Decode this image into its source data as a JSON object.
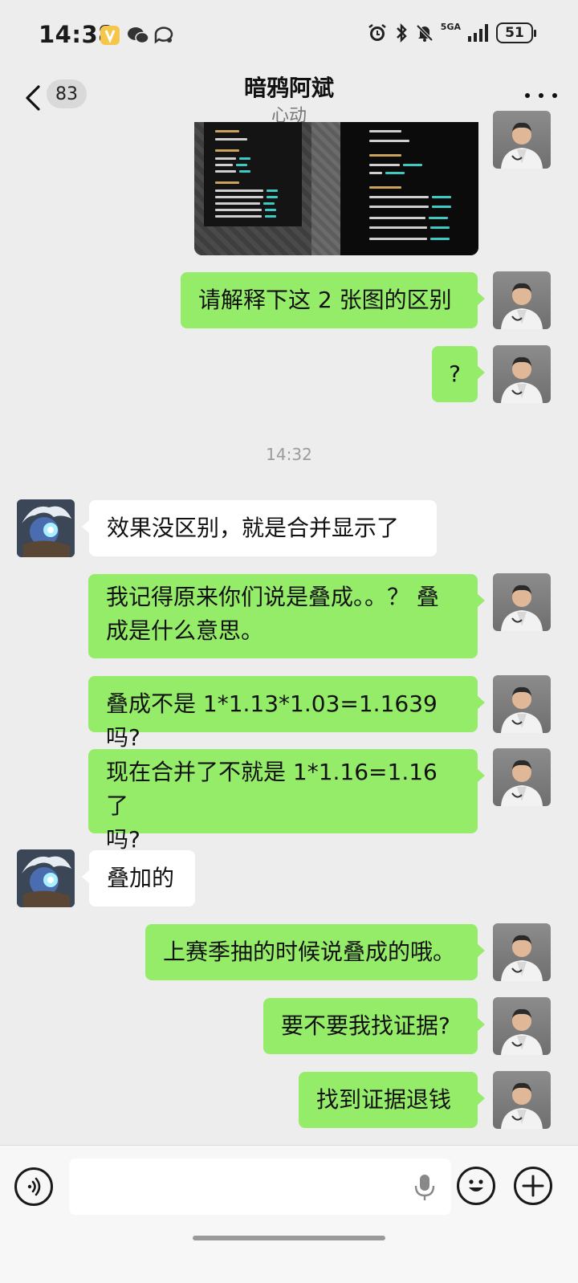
{
  "status_bar": {
    "time": "14:38",
    "network": "5GA",
    "battery": "51"
  },
  "nav": {
    "unread_count": "83",
    "title": "暗鸦阿斌",
    "subtitle": "心动"
  },
  "timestamp": "14:32",
  "messages": [
    {
      "sender": "me",
      "type": "image"
    },
    {
      "sender": "me",
      "text": "请解释下这 2 张图的区别"
    },
    {
      "sender": "me",
      "text": "?"
    },
    {
      "sender": "them",
      "text": "效果没区别，就是合并显示了"
    },
    {
      "sender": "me",
      "lines": [
        "我记得原来你们说是叠成。。？ 叠",
        "成是什么意思。"
      ]
    },
    {
      "sender": "me",
      "text": "叠成不是 1*1.13*1.03=1.1639 吗?"
    },
    {
      "sender": "me",
      "lines": [
        "现在合并了不就是 1*1.16=1.16 了",
        "吗?"
      ]
    },
    {
      "sender": "them",
      "text": "叠加的"
    },
    {
      "sender": "me",
      "text": "上赛季抽的时候说叠成的哦。"
    },
    {
      "sender": "me",
      "text": "要不要我找证据?"
    },
    {
      "sender": "me",
      "text": "找到证据退钱"
    }
  ],
  "input_bar": {
    "input_value": "",
    "icons": [
      "voice-icon",
      "mic-icon",
      "emoji-icon",
      "plus-icon"
    ]
  },
  "colors": {
    "background": "#ededed",
    "my_bubble": "#95ec69",
    "their_bubble": "#ffffff",
    "subtitle": "#777777",
    "timestamp": "#9b9b9b"
  }
}
